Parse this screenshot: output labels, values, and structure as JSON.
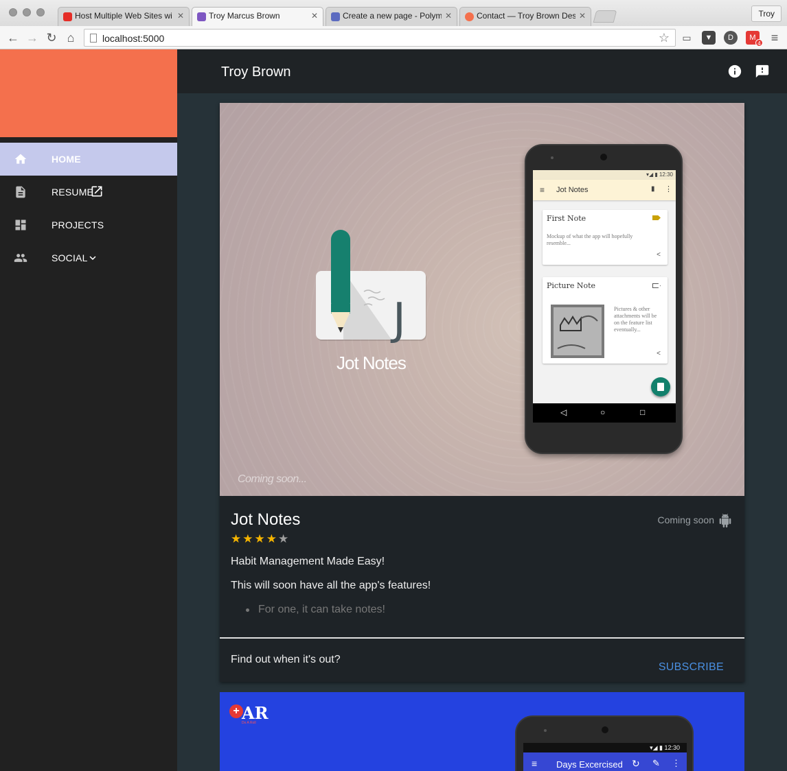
{
  "browser": {
    "tabs": [
      {
        "title": "Host Multiple Web Sites wi",
        "favicon_color": "#e52d27"
      },
      {
        "title": "Troy Marcus Brown",
        "favicon_color": "#7e57c2"
      },
      {
        "title": "Create a new page - Polym",
        "favicon_color": "#5c6bc0"
      },
      {
        "title": "Contact — Troy Brown Des",
        "favicon_color": "#f4704d"
      }
    ],
    "profile": "Troy",
    "url": "localhost:5000",
    "gmail_badge": "4"
  },
  "drawer": {
    "header_color": "#f4704d",
    "items": [
      {
        "label": "HOME",
        "icon": "home-icon"
      },
      {
        "label": "RESUME",
        "icon": "document-icon"
      },
      {
        "label": "PROJECTS",
        "icon": "dashboard-icon"
      },
      {
        "label": "SOCIAL",
        "icon": "people-icon"
      }
    ]
  },
  "appbar": {
    "title": "Troy Brown",
    "actions": [
      "info-icon",
      "feedback-icon"
    ]
  },
  "project": {
    "hero": {
      "overlay_text": "Coming soon...",
      "logo_title": "Jot Notes",
      "phone": {
        "status_time": "12:30",
        "app_title": "Jot Notes",
        "notes": [
          {
            "title": "First Note",
            "body": "Mockup of what the app will hopefully resemble..."
          },
          {
            "title": "Picture Note",
            "body": "Pictures & other attachments will be on the feature list eventually..."
          }
        ]
      }
    },
    "title": "Jot Notes",
    "rating": 4,
    "rating_max": 5,
    "status": "Coming soon",
    "paragraphs": [
      "Habit Management Made Easy!",
      "This will soon have all the app's features!"
    ],
    "bullets": [
      "For one, it can take notes!"
    ],
    "cta": "Find out when it's out?",
    "action": "SUBSCRIBE",
    "accent": "#4a90e2"
  },
  "project2": {
    "logo_letters": "AR",
    "logo_sub": "Do A Roll",
    "phone": {
      "status_time": "12:30",
      "app_title": "Days Excercised"
    }
  }
}
